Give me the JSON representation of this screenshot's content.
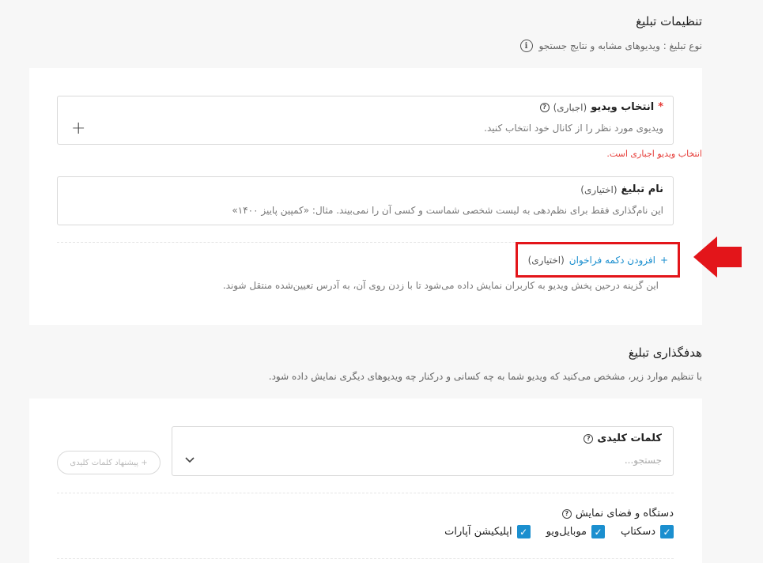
{
  "ad_settings": {
    "title": "تنظیمات تبلیغ",
    "ad_type_text": "نوع تبلیغ : ویدیوهای مشابه و نتایج جستجو",
    "video_field": {
      "required_mark": "*",
      "label": "انتخاب ویدیو",
      "qualifier": "(اجباری)",
      "help": "ویدیوی مورد نظر را از کانال خود انتخاب کنید.",
      "add_symbol": "+",
      "error": "انتخاب ویدیو اجباری است."
    },
    "name_field": {
      "label": "نام تبلیغ",
      "qualifier": "(اختیاری)",
      "help": "این نام‌گذاری فقط برای نظم‌دهی به لیست شخصی شماست و کسی آن را نمی‌بیند. مثال: «کمپین پاییز ۱۴۰۰»"
    },
    "cta": {
      "plus": "+",
      "link_label": "افزودن دکمه فراخوان",
      "qualifier": "(اختیاری)",
      "description": "این گزینه درحین پخش ویدیو به کاربران نمایش داده می‌شود تا با زدن روی آن، به آدرس تعیین‌شده منتقل شوند."
    }
  },
  "targeting": {
    "title": "هدفگذاری تبلیغ",
    "subtitle": "با تنظیم موارد زیر، مشخص می‌کنید که ویدیو شما به چه کسانی و درکنار چه ویدیوهای دیگری نمایش داده شود.",
    "keywords": {
      "label": "کلمات کلیدی",
      "placeholder": "جستجو...",
      "suggest_button": "+ پیشنهاد کلمات کلیدی"
    },
    "device": {
      "label": "دستگاه و فضای نمایش",
      "options": [
        "دسکتاپ",
        "موبایل‌ویو",
        "اپلیکیشن آپارات"
      ]
    }
  },
  "annotation": {
    "highlight_color": "#e3151a",
    "arrow_color": "#e3151a"
  },
  "colors": {
    "accent": "#1b8fcf",
    "error": "#e53935"
  }
}
